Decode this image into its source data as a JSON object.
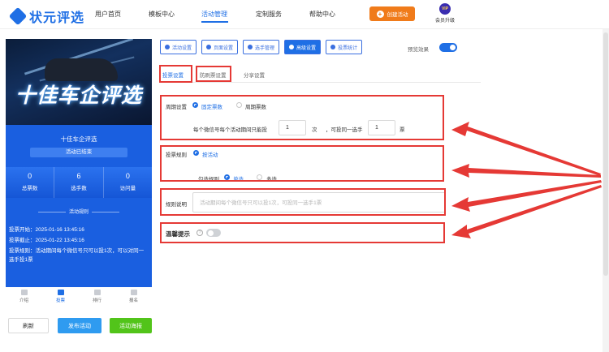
{
  "header": {
    "logo_text": "状元评选",
    "nav": [
      "用户首页",
      "模板中心",
      "活动管理",
      "定制服务",
      "帮助中心"
    ],
    "active_nav": "活动管理",
    "create_button": "创建活动",
    "vip_badge": "VIP",
    "vip_label": "会员升级"
  },
  "preview": {
    "banner_title": "十佳车企评选",
    "activity_name": "十佳车企评选",
    "status": "活动已结束",
    "stats": [
      {
        "value": "0",
        "label": "总票数"
      },
      {
        "value": "6",
        "label": "选手数"
      },
      {
        "value": "0",
        "label": "访问量"
      }
    ],
    "rules_heading": "活动规则",
    "rules": [
      "投票开始：2025-01-16 13:45:16",
      "投票截止：2025-01-22 13:45:16",
      "投票规则：活动期间每个微信号只可以投1次，可以对同一选手投1票"
    ],
    "tabs": [
      "介绍",
      "投票",
      "排行",
      "报名"
    ],
    "active_tab": "投票"
  },
  "actions": {
    "refresh": "刷新",
    "publish": "发布活动",
    "poster": "活动海报"
  },
  "settings": {
    "top_tabs": [
      "活动设置",
      "页面设置",
      "选手管理",
      "高级设置",
      "投票统计"
    ],
    "active_top_tab": "高级设置",
    "preview_label": "预览效果",
    "sub_tabs": [
      "投票设置",
      "防刷票设置",
      "分享设置"
    ],
    "active_sub_tab": "投票设置",
    "cycle": {
      "label": "周期设置",
      "options": [
        "固定票数",
        "周期票数"
      ],
      "selected": "固定票数",
      "sentence_prefix": "每个微信号每个活动期间只能投",
      "votes": "1",
      "unit_times": "次",
      "sentence_mid": "，可投同一选手",
      "same_votes": "1",
      "unit_votes": "票"
    },
    "vote_rule": {
      "label": "投票规则",
      "option": "按活动",
      "check_label": "勾选规则",
      "choices": [
        "单选",
        "多选"
      ],
      "selected": "单选"
    },
    "rule_desc": {
      "label": "规则说明",
      "placeholder": "活动期间每个微信号只可以投1次，可投同一选手1票"
    },
    "tips": {
      "label": "温馨提示",
      "help": "?",
      "enabled": false
    }
  },
  "colors": {
    "primary": "#1f6fe5",
    "annotation_red": "#e53935",
    "orange": "#f07b1a",
    "green": "#52c41a"
  }
}
